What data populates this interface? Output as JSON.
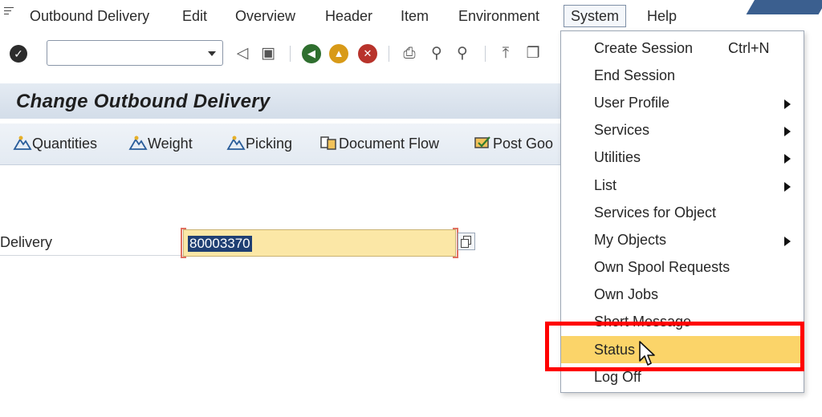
{
  "menubar": {
    "items": [
      "Outbound Delivery",
      "Edit",
      "Overview",
      "Header",
      "Item",
      "Environment",
      "System",
      "Help"
    ]
  },
  "toolbar": {
    "command_field_value": "",
    "icons": [
      "enter-icon",
      "back-icon",
      "save-icon",
      "exit-icon",
      "home-icon",
      "cancel-icon",
      "print-icon",
      "find-icon",
      "find-next-icon",
      "first-page-icon",
      "new-session-icon"
    ]
  },
  "title": "Change Outbound Delivery",
  "app_toolbar": {
    "buttons": [
      "Quantities",
      "Weight",
      "Picking",
      "Document Flow",
      "Post Goo"
    ]
  },
  "form": {
    "delivery_label": "Delivery",
    "delivery_value": "80003370"
  },
  "system_menu": {
    "items": [
      {
        "label": "Create Session",
        "shortcut": "Ctrl+N",
        "submenu": false
      },
      {
        "label": "End Session",
        "shortcut": "",
        "submenu": false
      },
      {
        "label": "User Profile",
        "shortcut": "",
        "submenu": true
      },
      {
        "label": "Services",
        "shortcut": "",
        "submenu": true
      },
      {
        "label": "Utilities",
        "shortcut": "",
        "submenu": true
      },
      {
        "label": "List",
        "shortcut": "",
        "submenu": true
      },
      {
        "label": "Services for Object",
        "shortcut": "",
        "submenu": false
      },
      {
        "label": "My Objects",
        "shortcut": "",
        "submenu": true
      },
      {
        "label": "Own Spool Requests",
        "shortcut": "",
        "submenu": false
      },
      {
        "label": "Own Jobs",
        "shortcut": "",
        "submenu": false
      },
      {
        "label": "Short Message",
        "shortcut": "",
        "submenu": false
      },
      {
        "label": "Status",
        "shortcut": "",
        "submenu": false,
        "highlighted": true
      },
      {
        "label": "Log Off",
        "shortcut": "",
        "submenu": false
      }
    ]
  },
  "colors": {
    "highlight": "#fbd469",
    "annotation_box": "#ff0000",
    "field_bg": "#fbe7a6",
    "selection": "#1f3f73"
  }
}
